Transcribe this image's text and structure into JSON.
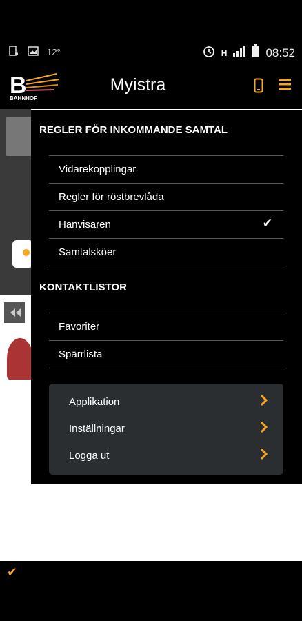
{
  "status_bar": {
    "temperature": "12°",
    "network": "H",
    "time": "08:52"
  },
  "app_bar": {
    "logo_text": "BAHNHOF",
    "title": "Myistra"
  },
  "menu": {
    "section_incoming": "REGLER FÖR INKOMMANDE SAMTAL",
    "incoming_items": [
      {
        "label": "Vidarekopplingar",
        "checked": false
      },
      {
        "label": "Regler för röstbrevlåda",
        "checked": false
      },
      {
        "label": "Hänvisaren",
        "checked": true
      },
      {
        "label": "Samtalsköer",
        "checked": false
      }
    ],
    "section_contacts": "KONTAKTLISTOR",
    "contact_items": [
      {
        "label": "Favoriter"
      },
      {
        "label": "Spärrlista"
      }
    ],
    "sub_items": [
      {
        "label": "Applikation"
      },
      {
        "label": "Inställningar"
      },
      {
        "label": "Logga ut"
      }
    ]
  },
  "colors": {
    "accent": "#f5a623",
    "panel": "#2b2e31",
    "divider": "#555555"
  },
  "icons": [
    "phone-icon",
    "hamburger-menu-icon",
    "checkmark-icon",
    "chevron-right-icon",
    "alarm-icon",
    "signal-icon",
    "battery-icon"
  ]
}
